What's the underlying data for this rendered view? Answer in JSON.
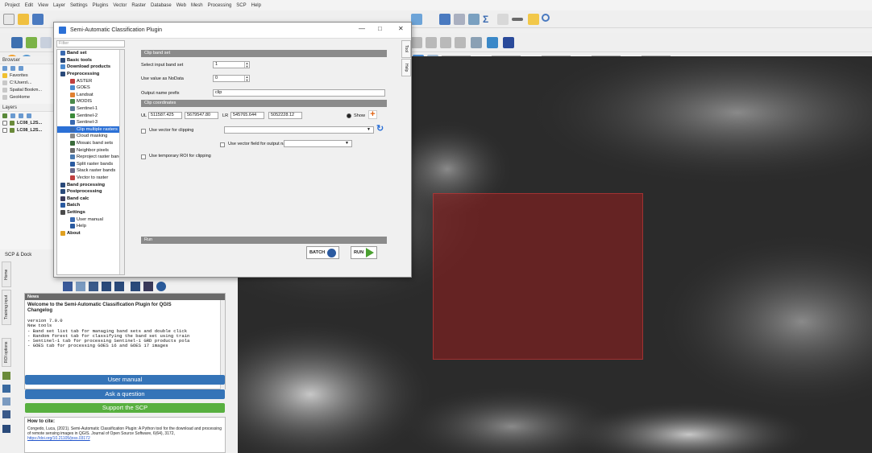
{
  "menubar": [
    "Project",
    "Edit",
    "View",
    "Layer",
    "Settings",
    "Plugins",
    "Vector",
    "Raster",
    "Database",
    "Web",
    "Mesh",
    "Processing",
    "SCP",
    "Help"
  ],
  "browser": {
    "label": "Browser",
    "items": [
      "Favorites",
      "C:\\Users\\...",
      "Spatial Bookm...",
      "GeoHome"
    ]
  },
  "layers": {
    "label": "Layers",
    "items": [
      "LC08_L2S...",
      "LC08_L2S..."
    ]
  },
  "toolbar3": {
    "values": [
      "0",
      "200",
      "0",
      "1",
      "2"
    ]
  },
  "dialog": {
    "title": "Semi-Automatic Classification Plugin",
    "filter_placeholder": "Filter",
    "tree": [
      {
        "t": "Band set",
        "b": true,
        "i": 0
      },
      {
        "t": "Basic tools",
        "b": true,
        "i": 0
      },
      {
        "t": "Download products",
        "b": true,
        "i": 0
      },
      {
        "t": "Preprocessing",
        "b": true,
        "i": 0
      },
      {
        "t": "ASTER",
        "b": false,
        "i": 1
      },
      {
        "t": "GOES",
        "b": false,
        "i": 1
      },
      {
        "t": "Landsat",
        "b": false,
        "i": 1
      },
      {
        "t": "MODIS",
        "b": false,
        "i": 1
      },
      {
        "t": "Sentinel-1",
        "b": false,
        "i": 1
      },
      {
        "t": "Sentinel-2",
        "b": false,
        "i": 1
      },
      {
        "t": "Sentinel-3",
        "b": false,
        "i": 1
      },
      {
        "t": "Clip multiple rasters",
        "b": false,
        "i": 1,
        "sel": true
      },
      {
        "t": "Cloud masking",
        "b": false,
        "i": 1
      },
      {
        "t": "Mosaic band sets",
        "b": false,
        "i": 1
      },
      {
        "t": "Neighbor pixels",
        "b": false,
        "i": 1
      },
      {
        "t": "Reproject raster bands",
        "b": false,
        "i": 1
      },
      {
        "t": "Split raster bands",
        "b": false,
        "i": 1
      },
      {
        "t": "Stack raster bands",
        "b": false,
        "i": 1
      },
      {
        "t": "Vector to raster",
        "b": false,
        "i": 1
      },
      {
        "t": "Band processing",
        "b": true,
        "i": 0
      },
      {
        "t": "Postprocessing",
        "b": true,
        "i": 0
      },
      {
        "t": "Band calc",
        "b": true,
        "i": 0
      },
      {
        "t": "Batch",
        "b": true,
        "i": 0
      },
      {
        "t": "Settings",
        "b": true,
        "i": 0
      },
      {
        "t": "User manual",
        "b": false,
        "i": 1
      },
      {
        "t": "Help",
        "b": false,
        "i": 1
      },
      {
        "t": "About",
        "b": true,
        "i": 0
      }
    ],
    "clip_band_set": "Clip band set",
    "select_input_label": "Select input band set",
    "select_input_value": "1",
    "nodata_label": "Use value as NoData",
    "nodata_value": "0",
    "prefix_label": "Output name prefix",
    "prefix_value": "clip",
    "clip_coords": "Clip coordinates",
    "ul_label": "UL",
    "ul_x": "511587.425",
    "ul_y": "5679547.80",
    "lr_label": "LR",
    "lr_x": "545765.644",
    "lr_y": "5052228.12",
    "show_label": "Show",
    "use_vector": "Use vector for clipping",
    "use_vector_field": "Use vector field for output name",
    "use_roi": "Use temporary ROI for clipping",
    "run_header": "Run",
    "batch": "BATCH",
    "run": "RUN",
    "vtabs": [
      "Tool",
      "Help"
    ]
  },
  "dock": {
    "title": "SCP & Dock",
    "news_header": "News",
    "news_title": "Welcome to the Semi-Automatic Classification Plugin for QGIS",
    "changelog": "Changelog",
    "news_lines": [
      "version 7.0.0",
      "New tools",
      "- Band set list tab for managing band sets and double click",
      "- Random forest tab for classifying the band set using train",
      "- Sentinel-1 tab for processing Sentinel-1 GRD products pola",
      "- GOES tab for processing GOES 16 and GOES 17 images"
    ],
    "user_manual": "User manual",
    "ask": "Ask a question",
    "support": "Support the SCP",
    "howto": "How to cite:",
    "cite_text": "Congedo, Luca, (2021). Semi-Automatic Classification Plugin: A Python tool for the download and processing of remote sensing images in QGIS. Journal of Open Source Software, 6(64), 3172,",
    "cite_link": "https://doi.org/10.21105/joss.03172",
    "side_tabs": [
      "Home",
      "Training input",
      "ROI options"
    ]
  },
  "colors": {
    "accent": "#2b70d6",
    "roi": "#962020",
    "bar_blue": "#3574b8",
    "bar_green": "#58b040"
  }
}
